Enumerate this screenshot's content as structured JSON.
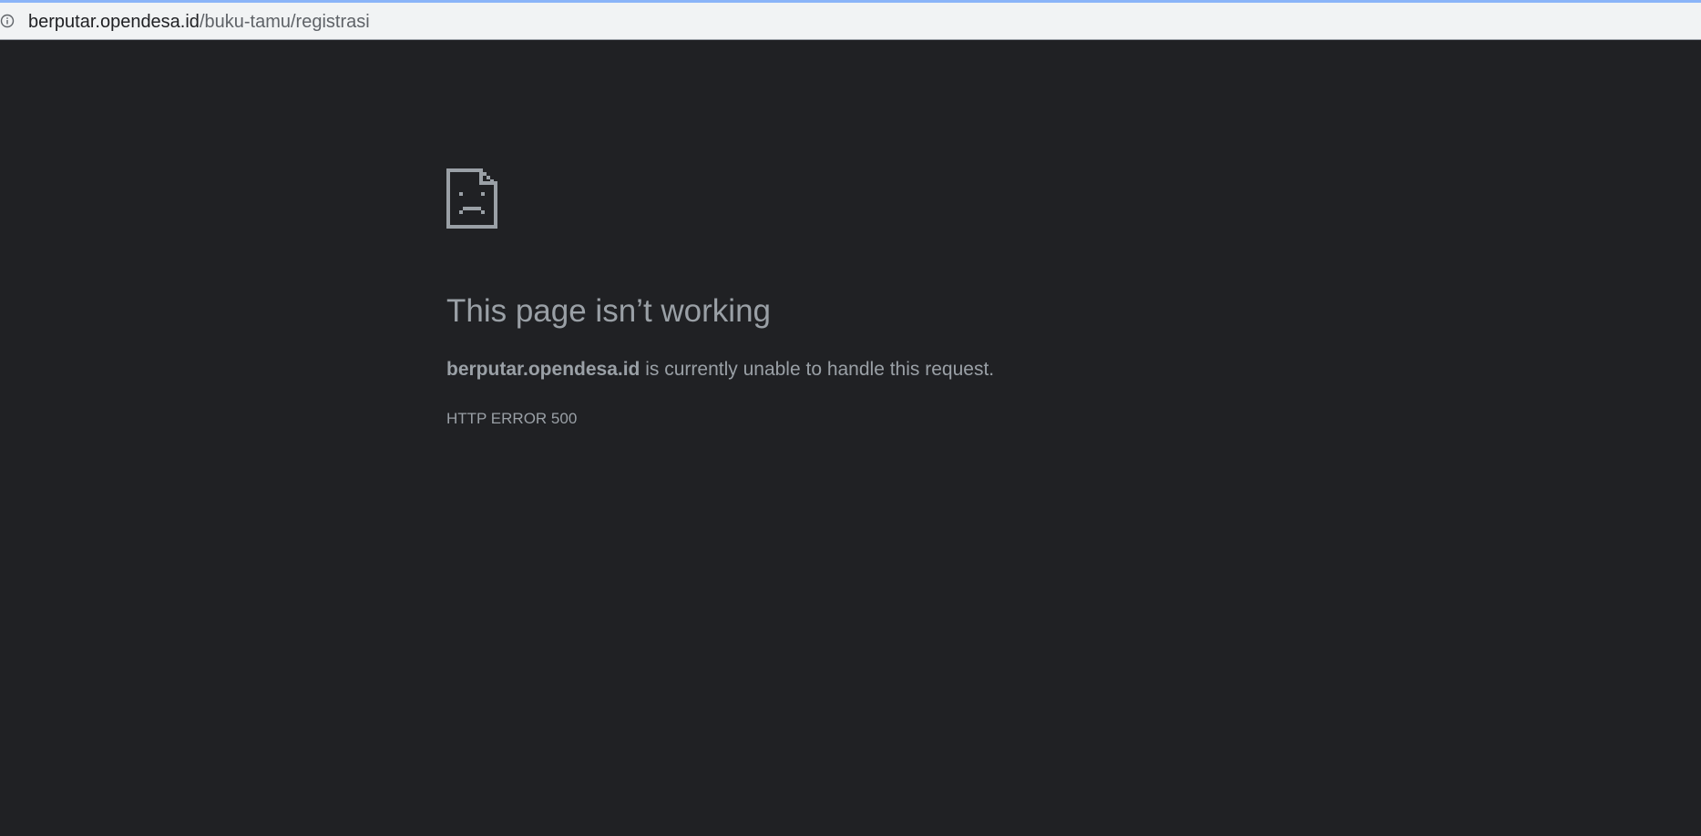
{
  "address_bar": {
    "host": "berputar.opendesa.id",
    "path": "/buku-tamu/registrasi",
    "icon": "info-icon"
  },
  "error": {
    "icon": "sad-page-icon",
    "title": "This page isn’t working",
    "host": "berputar.opendesa.id",
    "message": " is currently unable to handle this request.",
    "code": "HTTP ERROR 500"
  },
  "colors": {
    "background": "#202124",
    "text": "#9aa0a6",
    "address_bar": "#f1f3f4",
    "accent": "#8ab4f8"
  }
}
